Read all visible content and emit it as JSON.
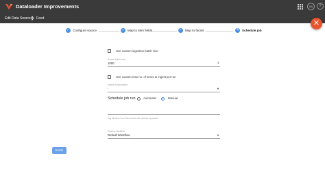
{
  "app": {
    "title": "Dataloader Improvements",
    "avatar_initials": "SS",
    "help_glyph": "?",
    "icons": [
      "logo-icon",
      "apps-grid-icon",
      "avatar",
      "help-icon"
    ]
  },
  "breadcrumbs": {
    "items": [
      "Edit Data Sources",
      "Feed"
    ],
    "separator": "❯"
  },
  "fab": {
    "glyph": "✕"
  },
  "stepper": {
    "steps": [
      {
        "label": "Configure source",
        "state": "done",
        "glyph": "✓"
      },
      {
        "label": "Map to item fields",
        "state": "done",
        "glyph": "✓"
      },
      {
        "label": "Map to facets",
        "state": "done",
        "glyph": "✓"
      },
      {
        "label": "Schedule job",
        "state": "current",
        "glyph": "4"
      }
    ]
  },
  "form": {
    "custom_batch_size_label": "Use custom ingestion batch size",
    "batch_size": {
      "label": "Source batch size",
      "value": "1000"
    },
    "custom_max_items_label": "Use custom max no. of items to ingest per run",
    "max_items": {
      "label": "Search Environment",
      "value": "-"
    },
    "schedule": {
      "label": "Schedule job run",
      "options": [
        "Automatic",
        "Manual"
      ],
      "selected": "Manual"
    },
    "tags_hint": "Tag all items from this source with desired keywords",
    "pipeline": {
      "label": "Pipeline Workflow",
      "value": "Default Workflow"
    },
    "save_label": "SAVE"
  },
  "colors": {
    "topbar": "#3a3a3a",
    "accent": "#4a90e2",
    "fab": "#e8542e",
    "save_button": "#6aa1e8"
  }
}
